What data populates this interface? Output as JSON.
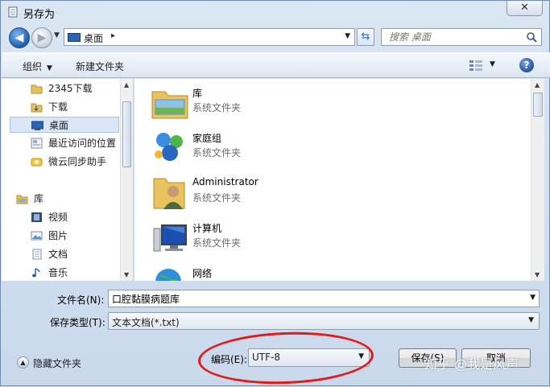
{
  "window": {
    "title": "另存为",
    "close_label": "✕"
  },
  "address": {
    "location": "桌面",
    "chevron": "▸",
    "search_placeholder": "搜索 桌面"
  },
  "toolbar": {
    "organize": "组织",
    "new_folder": "新建文件夹"
  },
  "nav": {
    "items": [
      {
        "label": "2345下载",
        "icon": "folder-icon"
      },
      {
        "label": "下载",
        "icon": "download-folder-icon"
      },
      {
        "label": "桌面",
        "icon": "desktop-icon",
        "selected": true
      },
      {
        "label": "最近访问的位置",
        "icon": "recent-places-icon"
      },
      {
        "label": "微云同步助手",
        "icon": "weiyun-icon"
      },
      {
        "label": "库",
        "icon": "library-icon"
      },
      {
        "label": "视频",
        "icon": "video-icon"
      },
      {
        "label": "图片",
        "icon": "pictures-icon"
      },
      {
        "label": "文档",
        "icon": "documents-icon"
      },
      {
        "label": "音乐",
        "icon": "music-icon"
      }
    ]
  },
  "files": [
    {
      "name": "库",
      "type": "系统文件夹",
      "icon": "library-folder-icon"
    },
    {
      "name": "家庭组",
      "type": "系统文件夹",
      "icon": "homegroup-icon"
    },
    {
      "name": "Administrator",
      "type": "系统文件夹",
      "icon": "user-folder-icon"
    },
    {
      "name": "计算机",
      "type": "系统文件夹",
      "icon": "computer-icon"
    },
    {
      "name": "网络",
      "type": "",
      "icon": "network-icon"
    }
  ],
  "form": {
    "filename_label": "文件名(N):",
    "filename_value": "口腔黏膜病题库",
    "filetype_label": "保存类型(T):",
    "filetype_value": "文本文档(*.txt)",
    "encoding_label": "编码(E):",
    "encoding_value": "UTF-8"
  },
  "footer": {
    "hide_folders": "隐藏文件夹",
    "save_button": "保存(S)",
    "cancel_button": "取消"
  },
  "watermark": "知乎 @我是风声",
  "colors": {
    "highlight": "#e11b1b",
    "selection": "#d9e6f5"
  }
}
